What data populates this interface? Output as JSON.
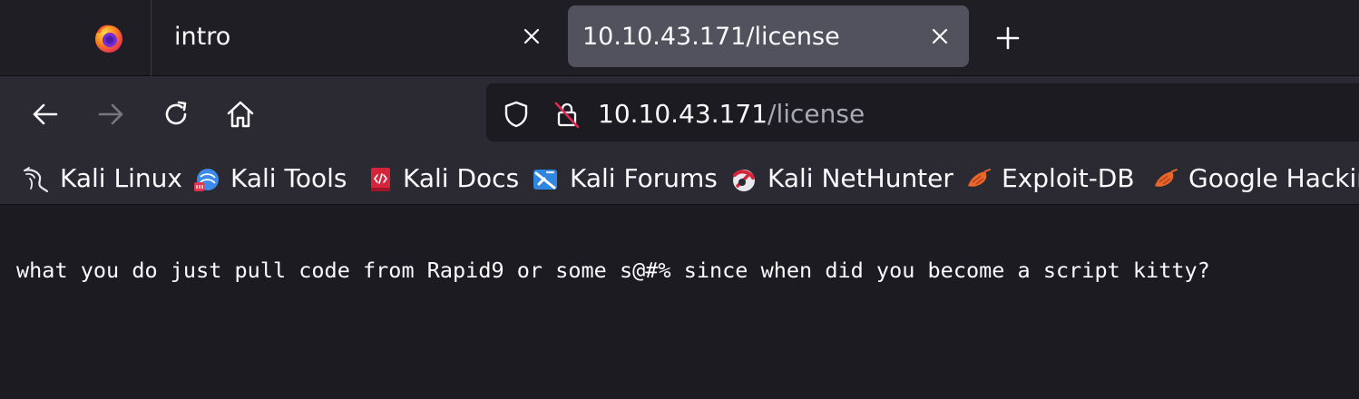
{
  "tabs": [
    {
      "title": "intro",
      "active": false
    },
    {
      "title": "10.10.43.171/license",
      "active": true
    }
  ],
  "url": {
    "host": "10.10.43.171",
    "path": "/license"
  },
  "bookmarks": [
    {
      "label": "Kali Linux",
      "icon": "kali-dragon-icon"
    },
    {
      "label": "Kali Tools",
      "icon": "kali-tools-icon"
    },
    {
      "label": "Kali Docs",
      "icon": "kali-docs-icon"
    },
    {
      "label": "Kali Forums",
      "icon": "kali-forums-icon"
    },
    {
      "label": "Kali NetHunter",
      "icon": "kali-nethunter-icon"
    },
    {
      "label": "Exploit-DB",
      "icon": "exploit-db-icon"
    },
    {
      "label": "Google Hackin",
      "icon": "google-hacking-icon"
    }
  ],
  "page": {
    "body_text": "what you do just pull code from Rapid9 or some s@#% since when did you become a script kitty?"
  },
  "colors": {
    "tab_strip_bg": "#1f1e25",
    "active_tab_bg": "#52525e",
    "toolbar_bg": "#2b2a33",
    "page_bg": "#1c1b22",
    "text": "#fbfbfe",
    "url_path_text": "#a9a9b3"
  }
}
